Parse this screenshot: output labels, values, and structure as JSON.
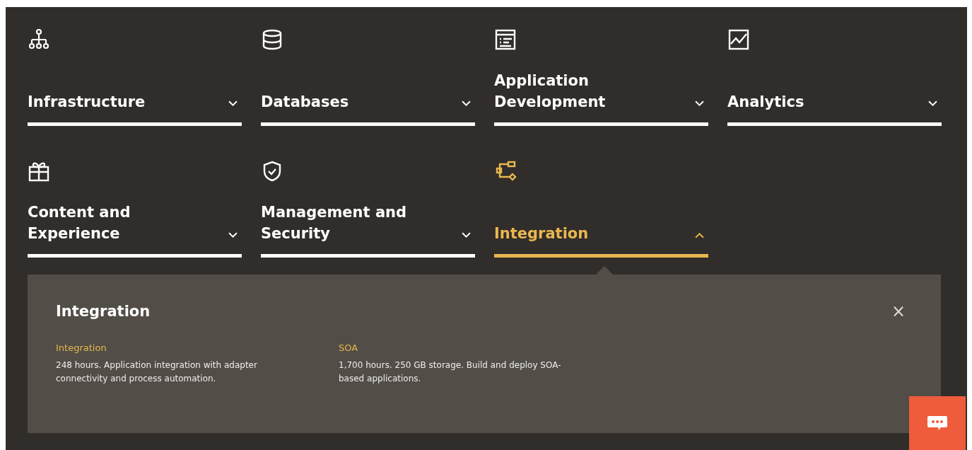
{
  "categories": [
    {
      "label": "Infrastructure",
      "expanded": false
    },
    {
      "label": "Databases",
      "expanded": false
    },
    {
      "label": "Application Development",
      "expanded": false
    },
    {
      "label": "Analytics",
      "expanded": false
    },
    {
      "label": "Content and Experience",
      "expanded": false
    },
    {
      "label": "Management and Security",
      "expanded": false
    },
    {
      "label": "Integration",
      "expanded": true
    }
  ],
  "panel": {
    "title": "Integration",
    "close": "×",
    "items": [
      {
        "title": "Integration",
        "description": "248 hours. Application integration with adapter connectivity and process automation."
      },
      {
        "title": "SOA",
        "description": "1,700 hours. 250 GB storage. Build and deploy SOA-based applications."
      }
    ]
  }
}
